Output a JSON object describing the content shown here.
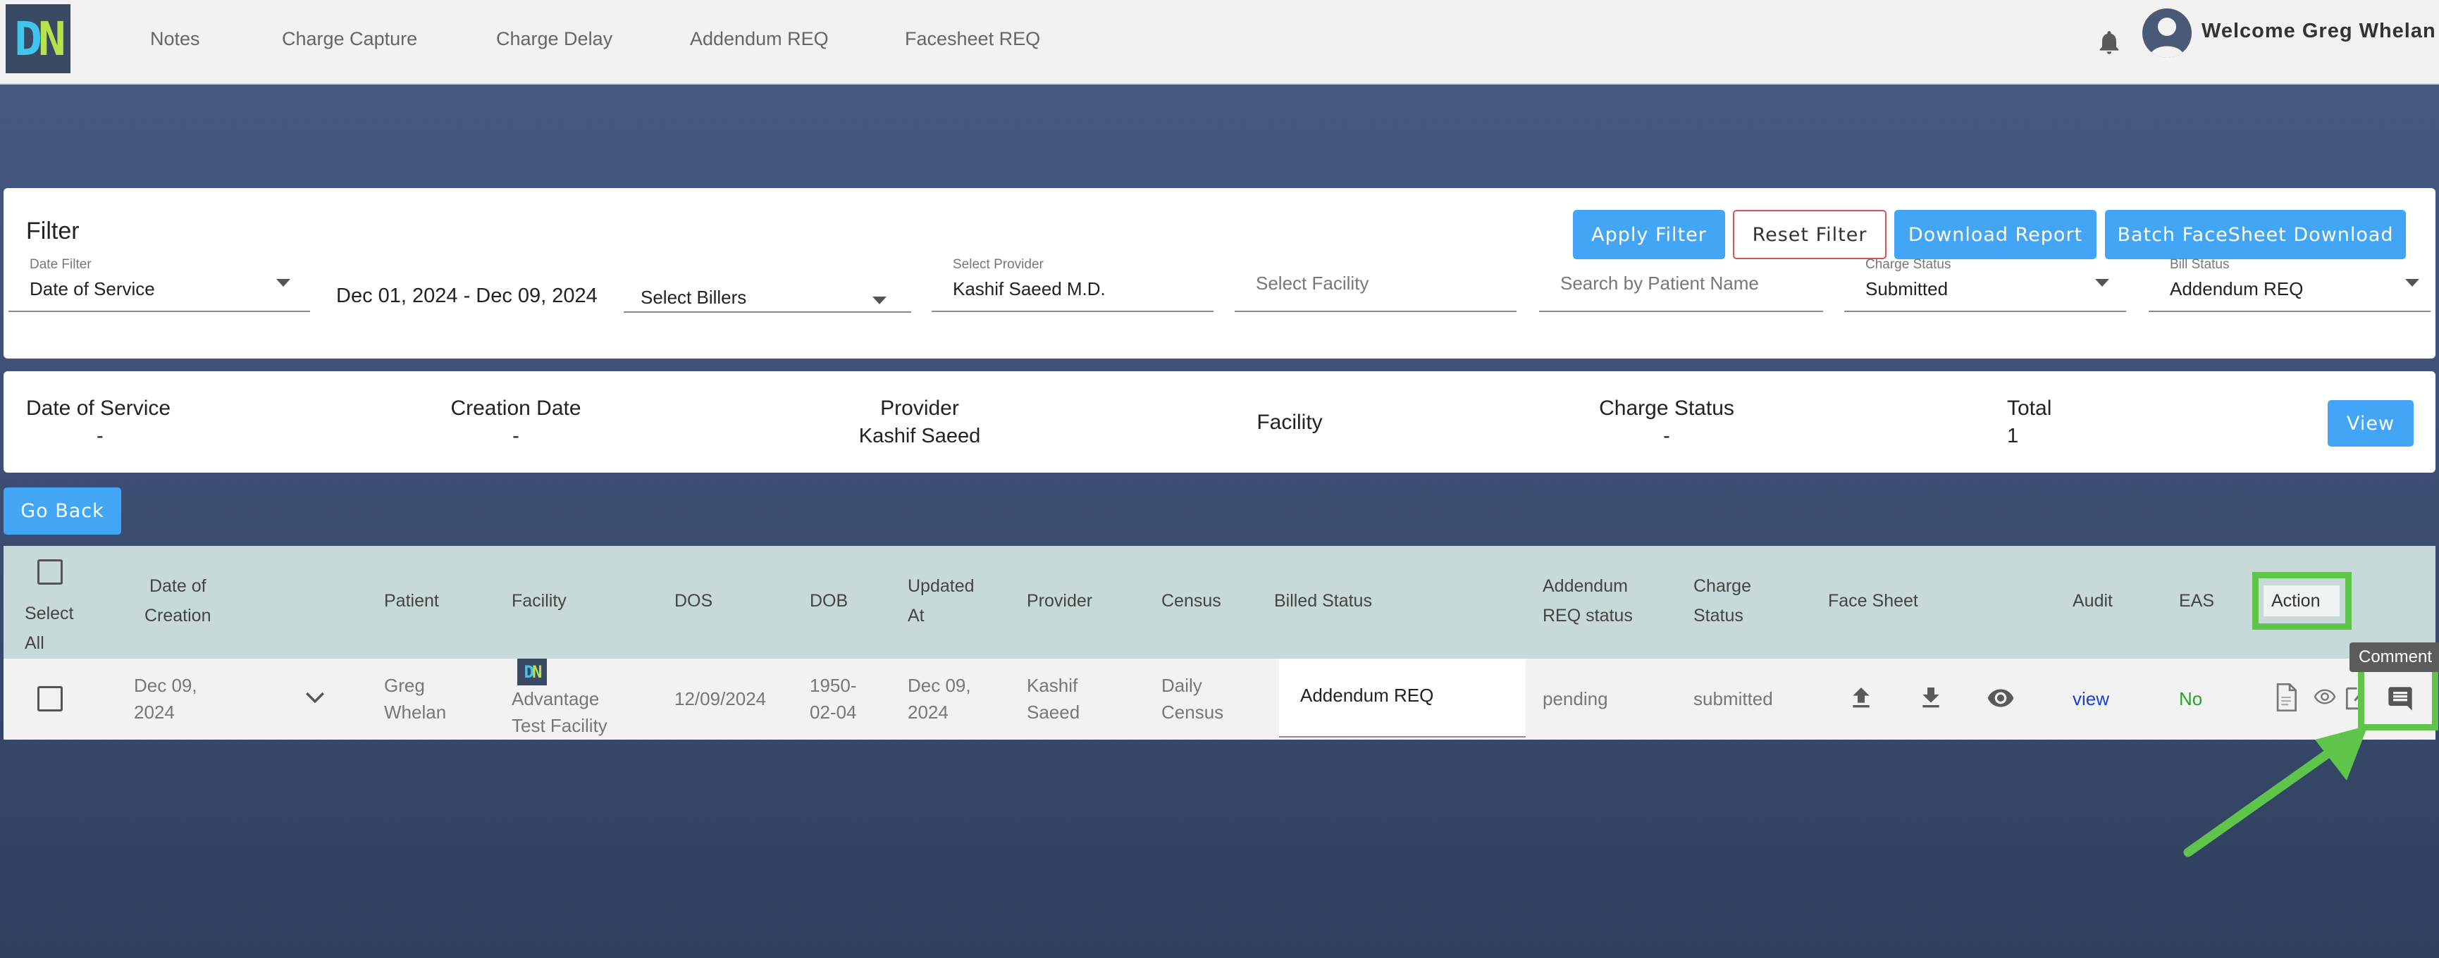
{
  "logo": {
    "d": "D",
    "n": "N"
  },
  "nav": {
    "items": [
      {
        "label": "Notes"
      },
      {
        "label": "Charge Capture"
      },
      {
        "label": "Charge Delay"
      },
      {
        "label": "Addendum REQ"
      },
      {
        "label": "Facesheet REQ"
      }
    ]
  },
  "user": {
    "welcome": "Welcome Greg Whelan",
    "avatar_icon": "user-avatar-icon",
    "bell_icon": "bell-icon"
  },
  "filter": {
    "title": "Filter",
    "buttons": {
      "apply": "Apply Filter",
      "reset": "Reset Filter",
      "download": "Download Report",
      "batch": "Batch FaceSheet Download"
    },
    "date_filter": {
      "label": "Date Filter",
      "value": "Date of Service"
    },
    "date_range": "Dec 01, 2024 - Dec 09, 2024",
    "billers": {
      "placeholder": "Select Billers"
    },
    "provider": {
      "label": "Select Provider",
      "value": "Kashif Saeed M.D."
    },
    "facility": {
      "placeholder": "Select Facility"
    },
    "patient_search": {
      "placeholder": "Search by Patient Name"
    },
    "charge_status": {
      "label": "Charge Status",
      "value": "Submitted"
    },
    "bill_status": {
      "label": "Bill Status",
      "value": "Addendum REQ"
    }
  },
  "summary": {
    "dos": {
      "label": "Date of Service",
      "value": "-"
    },
    "creation": {
      "label": "Creation Date",
      "value": "-"
    },
    "provider": {
      "label": "Provider",
      "value": "Kashif Saeed"
    },
    "facility": {
      "label": "Facility",
      "value": ""
    },
    "charge_status": {
      "label": "Charge Status",
      "value": "-"
    },
    "total": {
      "label": "Total",
      "value": "1"
    },
    "view_button": "View"
  },
  "go_back": "Go Back",
  "table": {
    "headers": {
      "select_all_1": "Select",
      "select_all_2": "All",
      "date_creation_1": "Date of",
      "date_creation_2": "Creation",
      "patient": "Patient",
      "facility": "Facility",
      "dos": "DOS",
      "dob": "DOB",
      "updated_1": "Updated",
      "updated_2": "At",
      "provider": "Provider",
      "census": "Census",
      "billed_status": "Billed Status",
      "addendum_1": "Addendum",
      "addendum_2": "REQ status",
      "charge_1": "Charge",
      "charge_2": "Status",
      "face_sheet": "Face Sheet",
      "audit": "Audit",
      "eas": "EAS",
      "action": "Action"
    },
    "rows": [
      {
        "date_creation_1": "Dec 09,",
        "date_creation_2": "2024",
        "patient_1": "Greg",
        "patient_2": "Whelan",
        "facility_1": "Advantage",
        "facility_2": "Test Facility",
        "dos": "12/09/2024",
        "dob_1": "1950-",
        "dob_2": "02-04",
        "updated_1": "Dec 09,",
        "updated_2": "2024",
        "provider_1": "Kashif",
        "provider_2": "Saeed",
        "census_1": "Daily",
        "census_2": "Census",
        "billed_status": "Addendum REQ",
        "addendum_status": "pending",
        "charge_status": "submitted",
        "audit": "view",
        "eas": "No"
      }
    ]
  },
  "tooltip": "Comment",
  "colors": {
    "accent_blue": "#42a5f5",
    "highlight_green": "#5fc44a",
    "table_header": "#c8d9da",
    "audit_link": "#1a3fd6",
    "eas_green": "#2e9e2e"
  }
}
